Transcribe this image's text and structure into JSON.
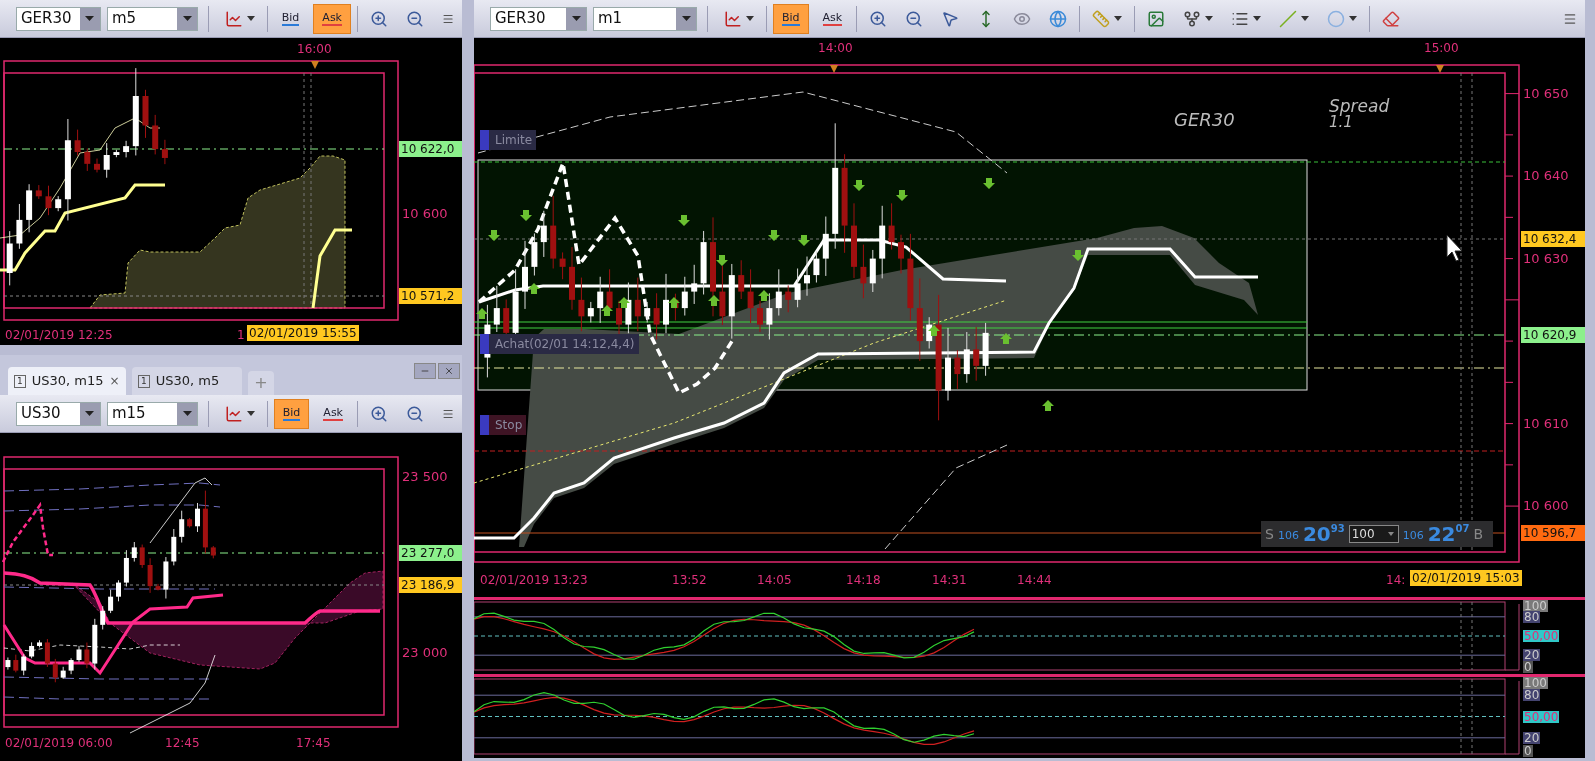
{
  "left_top": {
    "toolbar": {
      "symbol": "GER30",
      "timeframe": "m5",
      "bid": {
        "label": "Bid",
        "selected": false
      },
      "ask": {
        "label": "Ask",
        "selected": true
      }
    },
    "top_times": [
      "16:00"
    ],
    "y_labels": [
      "10 600"
    ],
    "price_tags": [
      {
        "text": "10 622,0",
        "color": "#8cf08c"
      },
      {
        "text": "10 571,2",
        "color": "#ffc820"
      }
    ],
    "x_labels": [
      "02/01/2019 12:25",
      "1"
    ],
    "cursor_time": "02/01/2019 15:55"
  },
  "left_bottom": {
    "tabs": [
      {
        "label": "US30, m15",
        "mark": "1",
        "selected": true,
        "close": "×"
      },
      {
        "label": "US30, m5",
        "mark": "1",
        "selected": false
      }
    ],
    "new_tab": "+",
    "toolbar": {
      "symbol": "US30",
      "timeframe": "m15",
      "bid": {
        "label": "Bid",
        "selected": true
      },
      "ask": {
        "label": "Ask",
        "selected": false
      }
    },
    "y_labels": [
      "23 500",
      "23 000"
    ],
    "price_tags": [
      {
        "text": "23 277,0",
        "color": "#8cf08c"
      },
      {
        "text": "23 186,9",
        "color": "#ffc820"
      }
    ],
    "x_labels": [
      "02/01/2019 06:00",
      "12:45",
      "17:45"
    ]
  },
  "main": {
    "toolbar": {
      "symbol": "GER30",
      "timeframe": "m1",
      "bid": {
        "label": "Bid",
        "selected": true
      },
      "ask": {
        "label": "Ask",
        "selected": false
      }
    },
    "top_times": [
      "14:00",
      "15:00"
    ],
    "instrument": "GER30",
    "spread_label": "Spread",
    "spread_value": "1.1",
    "orders": [
      {
        "label": "Limite",
        "color": "#2a2a44"
      },
      {
        "label": "Achat(02/01 14:12,4,4)",
        "color": "#2a2a44"
      },
      {
        "label": "Stop",
        "color": "#3e1424"
      }
    ],
    "y_labels": [
      "10 650",
      "10 640",
      "10 630",
      "10 610",
      "10 600"
    ],
    "price_tags": [
      {
        "text": "10 632,4",
        "color": "#ffc820"
      },
      {
        "text": "10 620,9",
        "color": "#8cf08c"
      },
      {
        "text": "10 596,7",
        "color": "#ff6a10"
      }
    ],
    "x_labels": [
      "02/01/2019 13:23",
      "13:52",
      "14:05",
      "14:18",
      "14:31",
      "14:44",
      "14:"
    ],
    "cursor_time": "02/01/2019 15:03",
    "trade_panel": {
      "sell_label": "S",
      "sell_volume": "106",
      "sell_big": "20",
      "sell_small": "93",
      "amount": "100",
      "buy_volume": "106",
      "buy_big": "22",
      "buy_small": "07",
      "buy_label": "B"
    },
    "oscillators": [
      {
        "levels": [
          {
            "text": "100",
            "color": "#7a7a7a"
          },
          {
            "text": "80",
            "color": "#444470"
          },
          {
            "text": "50,00",
            "color": "#30c8c8"
          },
          {
            "text": "20",
            "color": "#444470"
          },
          {
            "text": "0",
            "color": "#555555"
          }
        ]
      },
      {
        "levels": [
          {
            "text": "100",
            "color": "#7a7a7a"
          },
          {
            "text": "80",
            "color": "#444470"
          },
          {
            "text": "50,00",
            "color": "#30c8c8"
          },
          {
            "text": "20",
            "color": "#444470"
          },
          {
            "text": "0",
            "color": "#555555"
          }
        ]
      }
    ]
  }
}
